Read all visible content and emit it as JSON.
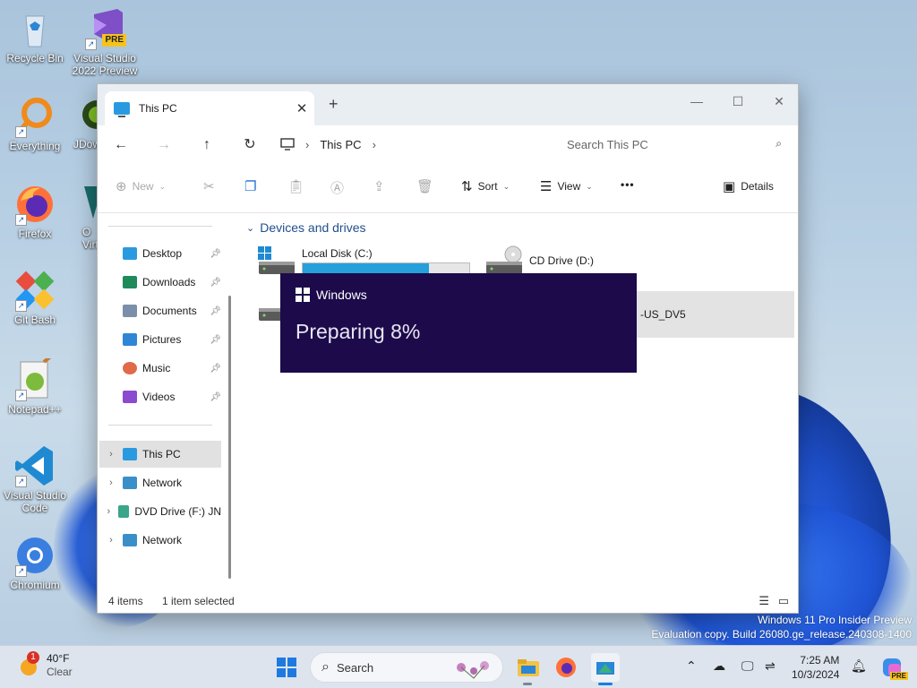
{
  "desktop": {
    "icons": [
      {
        "label": "Recycle Bin"
      },
      {
        "label": "Visual Studio 2022 Preview",
        "badge": "PRE"
      },
      {
        "label": "Everything"
      },
      {
        "label": "JDow"
      },
      {
        "label": "Firefox"
      },
      {
        "label": "O Virt"
      },
      {
        "label": "Git Bash"
      },
      {
        "label": "Notepad++"
      },
      {
        "label": "Visual Studio Code"
      },
      {
        "label": "Chromium"
      }
    ],
    "watermark_line1": "Windows 11 Pro Insider Preview",
    "watermark_line2": "Evaluation copy. Build 26080.ge_release.240308-1400"
  },
  "explorer": {
    "tab_title": "This PC",
    "tab_close": "✕",
    "new_tab": "+",
    "window_controls": {
      "minimize": "—",
      "maximize": "☐",
      "close": "✕"
    },
    "breadcrumb": [
      "This PC"
    ],
    "search_placeholder": "Search This PC",
    "commands": {
      "new": "New",
      "sort": "Sort",
      "view": "View",
      "more": "•••",
      "details": "Details"
    },
    "nav": {
      "quick": [
        {
          "label": "Desktop",
          "color": "#2a9ae0"
        },
        {
          "label": "Downloads",
          "color": "#1f8a5a"
        },
        {
          "label": "Documents",
          "color": "#7a8fa8"
        },
        {
          "label": "Pictures",
          "color": "#2f86d6"
        },
        {
          "label": "Music",
          "color": "#e06a4a"
        },
        {
          "label": "Videos",
          "color": "#8a4bd0"
        }
      ],
      "tree": [
        {
          "label": "This PC",
          "selected": true
        },
        {
          "label": "Network"
        },
        {
          "label": "DVD Drive (F:) JN"
        },
        {
          "label": "Network"
        }
      ]
    },
    "group_title": "Devices and drives",
    "drives": [
      {
        "name": "Local Disk (C:)",
        "used_fraction": 0.76
      },
      {
        "name": "CD Drive (D:)"
      }
    ],
    "partial_drive_label": "-US_DV5",
    "status": {
      "items": "4 items",
      "selected": "1 item selected"
    }
  },
  "overlay": {
    "brand": "Windows",
    "message": "Preparing 8%"
  },
  "taskbar": {
    "weather_temp": "40°F",
    "weather_desc": "Clear",
    "weather_badge": "1",
    "search_label": "Search",
    "time": "7:25 AM",
    "date": "10/3/2024",
    "copilot_badge": "PRE"
  }
}
